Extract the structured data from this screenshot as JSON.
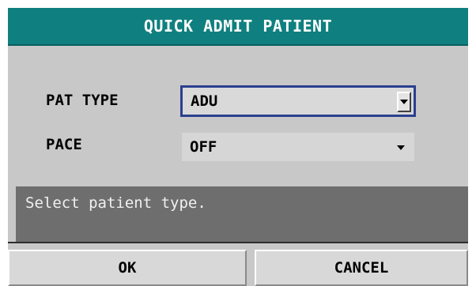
{
  "dialog": {
    "title": "QUICK ADMIT PATIENT",
    "fields": {
      "pat_type": {
        "label": "PAT TYPE",
        "value": "ADU"
      },
      "pace": {
        "label": "PACE",
        "value": "OFF"
      }
    },
    "help_text": "Select patient type.",
    "buttons": {
      "ok": "OK",
      "cancel": "CANCEL"
    }
  },
  "colors": {
    "title_bar": "#107f7f",
    "dialog_bg": "#c8c8c8",
    "help_bg": "#6e6e6e",
    "focus_border": "#2a3f8f"
  },
  "icons": {
    "pat_type_dropdown": "chevron-down-icon",
    "pace_dropdown": "chevron-down-icon"
  }
}
